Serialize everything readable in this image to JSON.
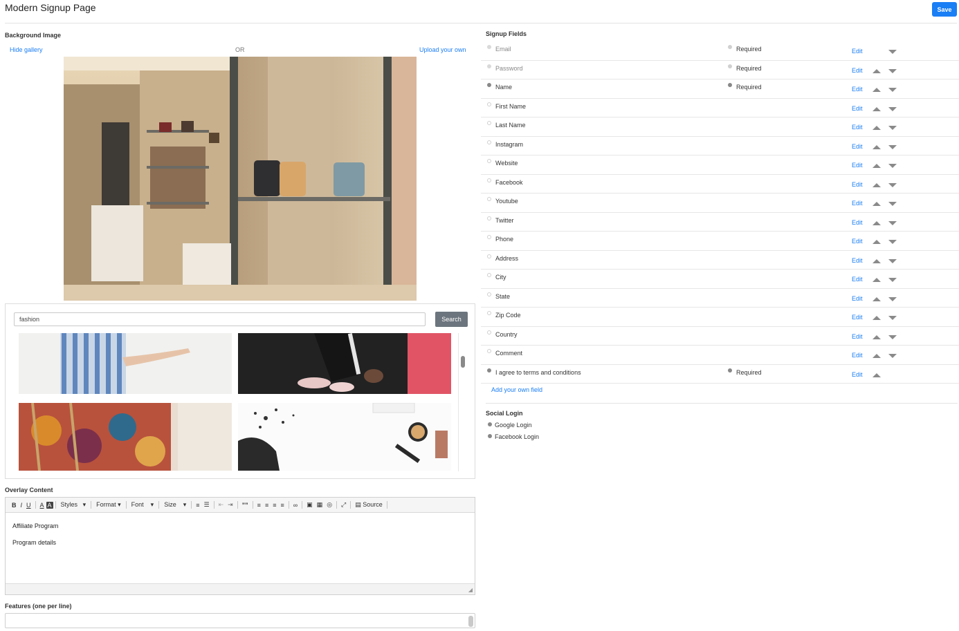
{
  "header": {
    "title": "Modern Signup Page",
    "save_label": "Save"
  },
  "background": {
    "label": "Background Image",
    "hide_gallery": "Hide gallery",
    "or": "OR",
    "upload": "Upload your own"
  },
  "gallery": {
    "search_value": "fashion",
    "search_label": "Search"
  },
  "overlay": {
    "label": "Overlay Content",
    "toolbar": {
      "bold": "B",
      "italic": "I",
      "underline": "U",
      "text_color": "A",
      "bg_color": "A",
      "styles": "Styles",
      "format": "Format",
      "font": "Font",
      "size": "Size",
      "blockquote": "””",
      "source": "Source"
    },
    "paragraphs": [
      "Affiliate Program",
      "Program details"
    ]
  },
  "features": {
    "label": "Features (one per line)"
  },
  "signup": {
    "label": "Signup Fields",
    "edit_label": "Edit",
    "required_label": "Required",
    "fields": [
      {
        "name": "Email",
        "required": true,
        "disabled": true,
        "up": false,
        "down": true
      },
      {
        "name": "Password",
        "required": true,
        "disabled": true,
        "up": true,
        "down": true
      },
      {
        "name": "Name",
        "required": true,
        "disabled": false,
        "checked": true,
        "up": true,
        "down": true
      },
      {
        "name": "First Name",
        "up": true,
        "down": true
      },
      {
        "name": "Last Name",
        "up": true,
        "down": true
      },
      {
        "name": "Instagram",
        "up": true,
        "down": true
      },
      {
        "name": "Website",
        "up": true,
        "down": true
      },
      {
        "name": "Facebook",
        "up": true,
        "down": true
      },
      {
        "name": "Youtube",
        "up": true,
        "down": true
      },
      {
        "name": "Twitter",
        "up": true,
        "down": true
      },
      {
        "name": "Phone",
        "up": true,
        "down": true
      },
      {
        "name": "Address",
        "up": true,
        "down": true
      },
      {
        "name": "City",
        "up": true,
        "down": true
      },
      {
        "name": "State",
        "up": true,
        "down": true
      },
      {
        "name": "Zip Code",
        "up": true,
        "down": true
      },
      {
        "name": "Country",
        "up": true,
        "down": true
      },
      {
        "name": "Comment",
        "up": true,
        "down": true
      },
      {
        "name": "I agree to terms and conditions",
        "required": true,
        "checked": true,
        "up": true,
        "down": false
      }
    ],
    "add_field": "Add your own field"
  },
  "social": {
    "label": "Social Login",
    "items": [
      "Google Login",
      "Facebook Login"
    ]
  }
}
